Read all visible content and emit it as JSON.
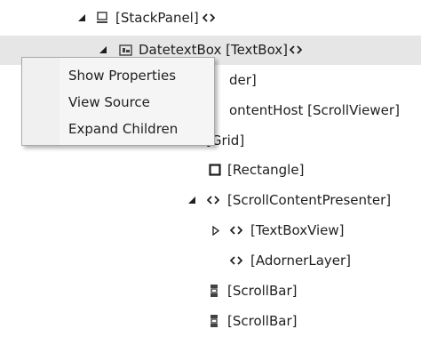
{
  "tree": {
    "rows": [
      {
        "label": "[StackPanel]",
        "icon": "stackpanel-icon",
        "expander": "expanded"
      },
      {
        "label": "DatetextBox [TextBox]",
        "icon": "textbox-icon",
        "expander": "expanded",
        "selected": true
      },
      {
        "label": "der]",
        "icon": "",
        "expander": ""
      },
      {
        "label": "ontentHost [ScrollViewer]",
        "icon": "",
        "expander": ""
      },
      {
        "label": "[Grid]",
        "icon": "",
        "expander": ""
      },
      {
        "label": "[Rectangle]",
        "icon": "rectangle-icon",
        "expander": ""
      },
      {
        "label": "[ScrollContentPresenter]",
        "icon": "code-icon",
        "expander": "expanded"
      },
      {
        "label": "[TextBoxView]",
        "icon": "code-icon",
        "expander": "collapsed"
      },
      {
        "label": "[AdornerLayer]",
        "icon": "code-icon",
        "expander": ""
      },
      {
        "label": "[ScrollBar]",
        "icon": "scrollbar-icon",
        "expander": ""
      },
      {
        "label": "[ScrollBar]",
        "icon": "scrollbar-icon",
        "expander": ""
      }
    ]
  },
  "context_menu": {
    "items": [
      {
        "label": "Show Properties"
      },
      {
        "label": "View Source"
      },
      {
        "label": "Expand Children"
      }
    ]
  },
  "colors": {
    "selected_row": "#e6e6e6",
    "menu_bg": "#f5f5f5",
    "menu_border": "#a9a9a9",
    "icon": "#424242"
  }
}
